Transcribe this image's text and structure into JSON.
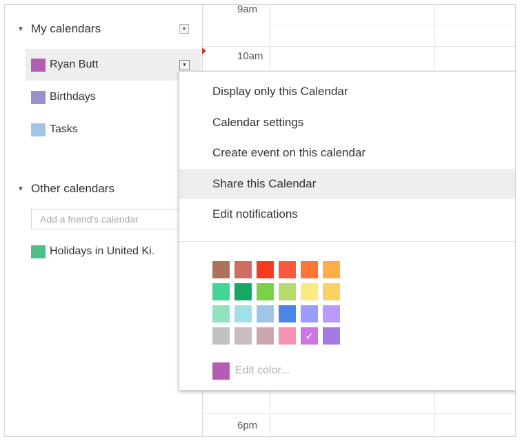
{
  "sidebar": {
    "my_calendars": {
      "header": "My calendars",
      "items": [
        {
          "label": "Ryan Butt",
          "color": "#b35db3"
        },
        {
          "label": "Birthdays",
          "color": "#9b8fcf"
        },
        {
          "label": "Tasks",
          "color": "#a2c4e8"
        }
      ]
    },
    "other_calendars": {
      "header": "Other calendars",
      "friend_placeholder": "Add a friend's calendar",
      "items": [
        {
          "label": "Holidays in United Ki.",
          "color": "#4fbf8a"
        }
      ]
    }
  },
  "grid": {
    "times": [
      "9am",
      "10am",
      "6pm"
    ]
  },
  "menu": {
    "items": [
      {
        "label": "Display only this Calendar"
      },
      {
        "label": "Calendar settings"
      },
      {
        "label": "Create event on this calendar"
      },
      {
        "label": "Share this Calendar",
        "highlighted": true
      },
      {
        "label": "Edit notifications"
      }
    ],
    "palette": [
      [
        "#ac725e",
        "#d06b64",
        "#f83a22",
        "#fa573c",
        "#ff7537",
        "#ffad46"
      ],
      [
        "#42d692",
        "#16a765",
        "#7bd148",
        "#b3dc6c",
        "#fbe983",
        "#fad165"
      ],
      [
        "#92e1c0",
        "#9fe1e7",
        "#9fc6e7",
        "#4986e7",
        "#9a9cff",
        "#b99aff"
      ],
      [
        "#c2c2c2",
        "#cabdbf",
        "#cca6ac",
        "#f691b2",
        "#cd74e6",
        "#a47ae2"
      ]
    ],
    "selected_check": "✓",
    "edit_color": {
      "label": "Edit color...",
      "color": "#b35db3"
    }
  }
}
